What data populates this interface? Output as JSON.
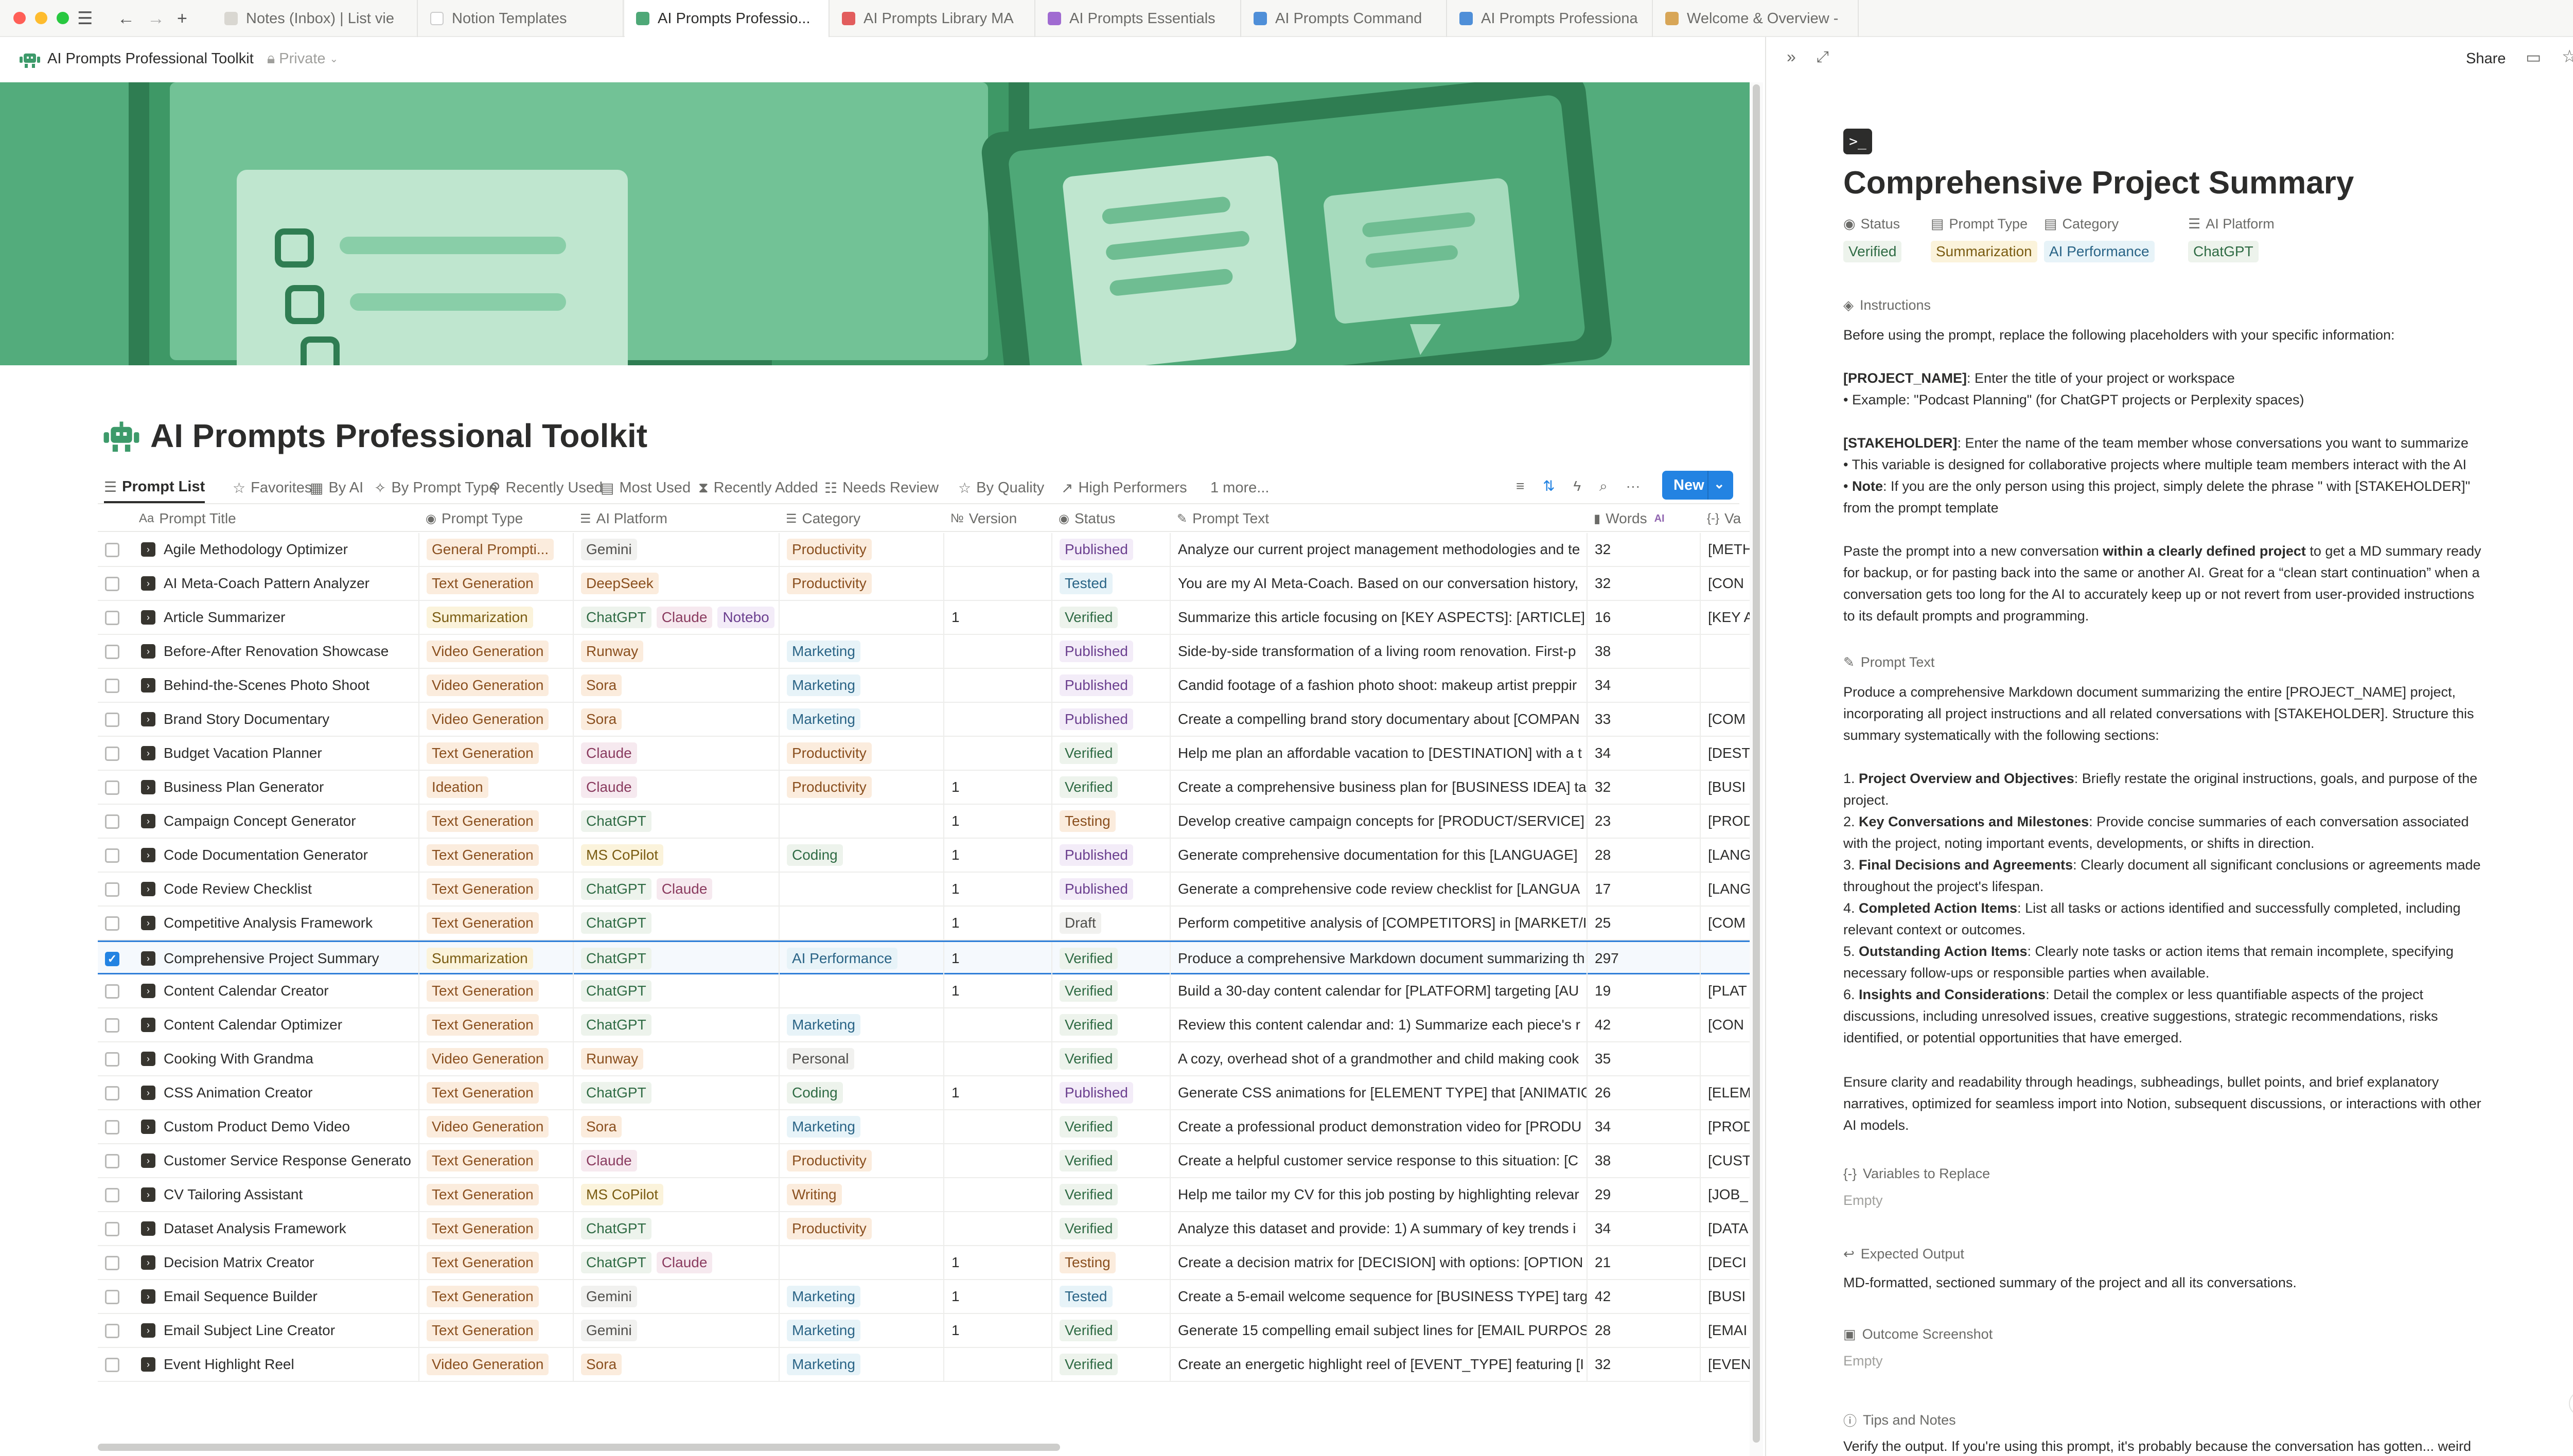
{
  "tabs": [
    {
      "label": "Notes (Inbox) | List vie",
      "color": "#d9d7d1",
      "glyph": ""
    },
    {
      "label": "Notion Templates",
      "color": "#ffffff",
      "glyph": ""
    },
    {
      "label": "AI Prompts Professio...",
      "color": "#4ea877",
      "glyph": "",
      "active": true
    },
    {
      "label": "AI Prompts Library MA",
      "color": "#e25d5d",
      "glyph": ""
    },
    {
      "label": "AI Prompts Essentials",
      "color": "#a06bd1",
      "glyph": ""
    },
    {
      "label": "AI Prompts Command",
      "color": "#4f8fd8",
      "glyph": ""
    },
    {
      "label": "AI Prompts Professiona",
      "color": "#4f8fd8",
      "glyph": ""
    },
    {
      "label": "Welcome & Overview -",
      "color": "#d8a657",
      "glyph": ""
    }
  ],
  "topbar": {
    "page_name": "AI Prompts Professional Toolkit",
    "privacy": "Private"
  },
  "page": {
    "title": "AI Prompts Professional Toolkit"
  },
  "views": [
    {
      "label": "Prompt List",
      "icon": "list-icon",
      "glyph": "☰",
      "active": true
    },
    {
      "label": "Favorites",
      "icon": "star-icon",
      "glyph": "☆"
    },
    {
      "label": "By AI",
      "icon": "board-icon",
      "glyph": "▦"
    },
    {
      "label": "By Prompt Type",
      "icon": "sparkle-icon",
      "glyph": "✧"
    },
    {
      "label": "Recently Used",
      "icon": "pin-icon",
      "glyph": "⚲"
    },
    {
      "label": "Most Used",
      "icon": "table-icon",
      "glyph": "▤"
    },
    {
      "label": "Recently Added",
      "icon": "hourglass-icon",
      "glyph": "⧗"
    },
    {
      "label": "Needs Review",
      "icon": "checklist-icon",
      "glyph": "☷"
    },
    {
      "label": "By Quality",
      "icon": "star-icon",
      "glyph": "☆"
    },
    {
      "label": "High Performers",
      "icon": "chart-icon",
      "glyph": "↗"
    },
    {
      "label": "1 more...",
      "icon": "",
      "glyph": ""
    }
  ],
  "toolbar": {
    "new_label": "New"
  },
  "columns": [
    {
      "label": "Prompt Title",
      "icon": "Aa"
    },
    {
      "label": "Prompt Type",
      "icon": "◉"
    },
    {
      "label": "AI Platform",
      "icon": "☰"
    },
    {
      "label": "Category",
      "icon": "☰"
    },
    {
      "label": "Version",
      "icon": "№"
    },
    {
      "label": "Status",
      "icon": "◉"
    },
    {
      "label": "Prompt Text",
      "icon": "✎"
    },
    {
      "label": "Words",
      "icon": "▮",
      "badge": "AI"
    },
    {
      "label": "Va",
      "icon": "{-}"
    }
  ],
  "tag_colors": {
    "General Prompti...": [
      "#fbecdd",
      "#8a4f1e"
    ],
    "Text Generation": [
      "#fbecdd",
      "#8a4f1e"
    ],
    "Summarization": [
      "#fbf3db",
      "#7a5c12"
    ],
    "Video Generation": [
      "#fbecdd",
      "#8a4f1e"
    ],
    "Ideation": [
      "#fbecdd",
      "#8a4f1e"
    ],
    "Gemini": [
      "#f1f1ef",
      "#4f4e4b"
    ],
    "DeepSeek": [
      "#fbecdd",
      "#8a4f1e"
    ],
    "ChatGPT": [
      "#edf3ec",
      "#2f6b44"
    ],
    "Claude": [
      "#f6e9ef",
      "#8a3b5f"
    ],
    "Notebo": [
      "#f3ecf8",
      "#6b3f8f"
    ],
    "Runway": [
      "#fbecdd",
      "#8a4f1e"
    ],
    "Sora": [
      "#fbecdd",
      "#8a4f1e"
    ],
    "MS CoPilot": [
      "#fbf3db",
      "#7a5c12"
    ],
    "Productivity": [
      "#fbecdd",
      "#8a4f1e"
    ],
    "Marketing": [
      "#e7f3f8",
      "#2a6486"
    ],
    "Coding": [
      "#edf3ec",
      "#2f6b44"
    ],
    "AI Performance": [
      "#e7f3f8",
      "#2a6486"
    ],
    "Personal": [
      "#f1f1ef",
      "#4f4e4b"
    ],
    "Writing": [
      "#fbecdd",
      "#8a4f1e"
    ],
    "Published": [
      "#f3ecf8",
      "#6b3f8f"
    ],
    "Tested": [
      "#e7f3f8",
      "#2a6486"
    ],
    "Verified": [
      "#edf3ec",
      "#2f6b44"
    ],
    "Testing": [
      "#fbecdd",
      "#8a4f1e"
    ],
    "Draft": [
      "#f1f1ef",
      "#4f4e4b"
    ]
  },
  "rows": [
    {
      "title": "Agile Methodology Optimizer",
      "type": "General Prompti...",
      "platforms": [
        "Gemini"
      ],
      "category": "Productivity",
      "version": "",
      "status": "Published",
      "text": "Analyze our current project management methodologies and te",
      "words": "32",
      "vars": "[METH"
    },
    {
      "title": "AI Meta-Coach Pattern Analyzer",
      "type": "Text Generation",
      "platforms": [
        "DeepSeek"
      ],
      "category": "Productivity",
      "version": "",
      "status": "Tested",
      "text": "You are my AI Meta-Coach. Based on our conversation history,",
      "words": "32",
      "vars": "[CON"
    },
    {
      "title": "Article Summarizer",
      "type": "Summarization",
      "platforms": [
        "ChatGPT",
        "Claude",
        "Notebo"
      ],
      "category": "",
      "version": "1",
      "status": "Verified",
      "text": "Summarize this article focusing on [KEY ASPECTS]: [ARTICLE]",
      "words": "16",
      "vars": "[KEY A"
    },
    {
      "title": "Before-After Renovation Showcase",
      "type": "Video Generation",
      "platforms": [
        "Runway"
      ],
      "category": "Marketing",
      "version": "",
      "status": "Published",
      "text": "Side-by-side transformation of a living room renovation. First-p",
      "words": "38",
      "vars": ""
    },
    {
      "title": "Behind-the-Scenes Photo Shoot",
      "type": "Video Generation",
      "platforms": [
        "Sora"
      ],
      "category": "Marketing",
      "version": "",
      "status": "Published",
      "text": "Candid footage of a fashion photo shoot: makeup artist preppir",
      "words": "34",
      "vars": ""
    },
    {
      "title": "Brand Story Documentary",
      "type": "Video Generation",
      "platforms": [
        "Sora"
      ],
      "category": "Marketing",
      "version": "",
      "status": "Published",
      "text": "Create a compelling brand story documentary about [COMPAN",
      "words": "33",
      "vars": "[COM"
    },
    {
      "title": "Budget Vacation Planner",
      "type": "Text Generation",
      "platforms": [
        "Claude"
      ],
      "category": "Productivity",
      "version": "",
      "status": "Verified",
      "text": "Help me plan an affordable vacation to [DESTINATION] with a t",
      "words": "34",
      "vars": "[DEST"
    },
    {
      "title": "Business Plan Generator",
      "type": "Ideation",
      "platforms": [
        "Claude"
      ],
      "category": "Productivity",
      "version": "1",
      "status": "Verified",
      "text": "Create a comprehensive business plan for [BUSINESS IDEA] ta",
      "words": "32",
      "vars": "[BUSI"
    },
    {
      "title": "Campaign Concept Generator",
      "type": "Text Generation",
      "platforms": [
        "ChatGPT"
      ],
      "category": "",
      "version": "1",
      "status": "Testing",
      "text": "Develop creative campaign concepts for [PRODUCT/SERVICE]",
      "words": "23",
      "vars": "[PROD"
    },
    {
      "title": "Code Documentation Generator",
      "type": "Text Generation",
      "platforms": [
        "MS CoPilot"
      ],
      "category": "Coding",
      "version": "1",
      "status": "Published",
      "text": "Generate comprehensive documentation for this [LANGUAGE]",
      "words": "28",
      "vars": "[LANG"
    },
    {
      "title": "Code Review Checklist",
      "type": "Text Generation",
      "platforms": [
        "ChatGPT",
        "Claude"
      ],
      "category": "",
      "version": "1",
      "status": "Published",
      "text": "Generate a comprehensive code review checklist for [LANGUA",
      "words": "17",
      "vars": "[LANG"
    },
    {
      "title": "Competitive Analysis Framework",
      "type": "Text Generation",
      "platforms": [
        "ChatGPT"
      ],
      "category": "",
      "version": "1",
      "status": "Draft",
      "text": "Perform competitive analysis of [COMPETITORS] in [MARKET/II",
      "words": "25",
      "vars": "[COM"
    },
    {
      "title": "Comprehensive Project Summary",
      "type": "Summarization",
      "platforms": [
        "ChatGPT"
      ],
      "category": "AI Performance",
      "version": "1",
      "status": "Verified",
      "text": "Produce a comprehensive Markdown document summarizing th",
      "words": "297",
      "vars": "",
      "selected": true
    },
    {
      "title": "Content Calendar Creator",
      "type": "Text Generation",
      "platforms": [
        "ChatGPT"
      ],
      "category": "",
      "version": "1",
      "status": "Verified",
      "text": "Build a 30-day content calendar for [PLATFORM] targeting [AU",
      "words": "19",
      "vars": "[PLAT"
    },
    {
      "title": "Content Calendar Optimizer",
      "type": "Text Generation",
      "platforms": [
        "ChatGPT"
      ],
      "category": "Marketing",
      "version": "",
      "status": "Verified",
      "text": "Review this content calendar and: 1) Summarize each piece's r",
      "words": "42",
      "vars": "[CON"
    },
    {
      "title": "Cooking With Grandma",
      "type": "Video Generation",
      "platforms": [
        "Runway"
      ],
      "category": "Personal",
      "version": "",
      "status": "Verified",
      "text": "A cozy, overhead shot of a grandmother and child making cook",
      "words": "35",
      "vars": ""
    },
    {
      "title": "CSS Animation Creator",
      "type": "Text Generation",
      "platforms": [
        "ChatGPT"
      ],
      "category": "Coding",
      "version": "1",
      "status": "Published",
      "text": "Generate CSS animations for [ELEMENT TYPE] that [ANIMATIC",
      "words": "26",
      "vars": "[ELEM"
    },
    {
      "title": "Custom Product Demo Video",
      "type": "Video Generation",
      "platforms": [
        "Sora"
      ],
      "category": "Marketing",
      "version": "",
      "status": "Verified",
      "text": "Create a professional product demonstration video for [PRODU",
      "words": "34",
      "vars": "[PROD"
    },
    {
      "title": "Customer Service Response Generato",
      "type": "Text Generation",
      "platforms": [
        "Claude"
      ],
      "category": "Productivity",
      "version": "",
      "status": "Verified",
      "text": "Create a helpful customer service response to this situation: [C",
      "words": "38",
      "vars": "[CUST"
    },
    {
      "title": "CV Tailoring Assistant",
      "type": "Text Generation",
      "platforms": [
        "MS CoPilot"
      ],
      "category": "Writing",
      "version": "",
      "status": "Verified",
      "text": "Help me tailor my CV for this job posting by highlighting relevar",
      "words": "29",
      "vars": "[JOB_"
    },
    {
      "title": "Dataset Analysis Framework",
      "type": "Text Generation",
      "platforms": [
        "ChatGPT"
      ],
      "category": "Productivity",
      "version": "",
      "status": "Verified",
      "text": "Analyze this dataset and provide: 1) A summary of key trends i",
      "words": "34",
      "vars": "[DATA"
    },
    {
      "title": "Decision Matrix Creator",
      "type": "Text Generation",
      "platforms": [
        "ChatGPT",
        "Claude"
      ],
      "category": "",
      "version": "1",
      "status": "Testing",
      "text": "Create a decision matrix for [DECISION] with options: [OPTION",
      "words": "21",
      "vars": "[DECI"
    },
    {
      "title": "Email Sequence Builder",
      "type": "Text Generation",
      "platforms": [
        "Gemini"
      ],
      "category": "Marketing",
      "version": "1",
      "status": "Tested",
      "text": "Create a 5-email welcome sequence for [BUSINESS TYPE] targ",
      "words": "42",
      "vars": "[BUSI"
    },
    {
      "title": "Email Subject Line Creator",
      "type": "Text Generation",
      "platforms": [
        "Gemini"
      ],
      "category": "Marketing",
      "version": "1",
      "status": "Verified",
      "text": "Generate 15 compelling email subject lines for [EMAIL PURPOS",
      "words": "28",
      "vars": "[EMAI"
    },
    {
      "title": "Event Highlight Reel",
      "type": "Video Generation",
      "platforms": [
        "Sora"
      ],
      "category": "Marketing",
      "version": "",
      "status": "Verified",
      "text": "Create an energetic highlight reel of [EVENT_TYPE] featuring [I",
      "words": "32",
      "vars": "[EVEN"
    }
  ],
  "panel": {
    "share_label": "Share",
    "title": "Comprehensive Project Summary",
    "props": [
      {
        "label": "Status",
        "value": "Verified"
      },
      {
        "label": "Prompt Type",
        "value": "Summarization"
      },
      {
        "label": "Category",
        "value": "AI Performance"
      },
      {
        "label": "AI Platform",
        "value": "ChatGPT"
      }
    ],
    "instructions_label": "Instructions",
    "instructions_intro": "Before using the prompt, replace the following placeholders with your specific information:",
    "project_name_key": "[PROJECT_NAME]",
    "project_name_desc": ": Enter the title of your project or workspace",
    "project_name_example": "• Example: \"Podcast Planning\" (for ChatGPT projects or Perplexity spaces)",
    "stakeholder_key": "[STAKEHOLDER]",
    "stakeholder_desc": ": Enter the name of the team member whose conversations you want to summarize",
    "stakeholder_line2": "• This variable is designed for collaborative projects where multiple team members interact with the AI",
    "note_prefix": "• ",
    "note_key": "Note",
    "note_text": ": If you are the only person using this project, simply delete the phrase \" with [STAKEHOLDER]\" from the prompt template",
    "paste_1": "Paste the prompt into a new conversation ",
    "paste_bold": "within a clearly defined project",
    "paste_2": " to get a MD summary ready for backup, or for pasting back into the same or another AI. Great for a “clean start continuation” when a conversation gets too long for the AI to accurately keep up or not revert from user-provided instructions to its default prompts and programming.",
    "prompt_text_label": "Prompt Text",
    "prompt_intro": "Produce a comprehensive Markdown document summarizing the entire [PROJECT_NAME] project, incorporating all project instructions and all related conversations with [STAKEHOLDER]. Structure this summary systematically with the following sections:",
    "items": [
      {
        "num": "1. ",
        "key": "Project Overview and Objectives",
        "text": ": Briefly restate the original instructions, goals, and purpose of the project."
      },
      {
        "num": "2. ",
        "key": "Key Conversations and Milestones",
        "text": ": Provide concise summaries of each conversation associated with the project, noting important events, developments, or shifts in direction."
      },
      {
        "num": "3. ",
        "key": "Final Decisions and Agreements",
        "text": ": Clearly document all significant conclusions or agreements made throughout the project's lifespan."
      },
      {
        "num": "4. ",
        "key": "Completed Action Items",
        "text": ": List all tasks or actions identified and successfully completed, including relevant context or outcomes."
      },
      {
        "num": "5. ",
        "key": "Outstanding Action Items",
        "text": ": Clearly note tasks or action items that remain incomplete, specifying necessary follow-ups or responsible parties when available."
      },
      {
        "num": "6. ",
        "key": "Insights and Considerations",
        "text": ": Detail the complex or less quantifiable aspects of the project discussions, including unresolved issues, creative suggestions, strategic recommendations, risks identified, or potential opportunities that have emerged."
      }
    ],
    "prompt_outro": "Ensure clarity and readability through headings, subheadings, bullet points, and brief explanatory narratives, optimized for seamless import into Notion, subsequent discussions, or interactions with other AI models.",
    "variables_label": "Variables to Replace",
    "variables_value": "Empty",
    "expected_label": "Expected Output",
    "expected_value": "MD-formatted, sectioned summary of the project and all its conversations.",
    "screenshot_label": "Outcome Screenshot",
    "screenshot_value": "Empty",
    "tips_label": "Tips and Notes",
    "tips_value": "Verify the output. If you're using this prompt, it's probably because the conversation has gotten... weird"
  }
}
